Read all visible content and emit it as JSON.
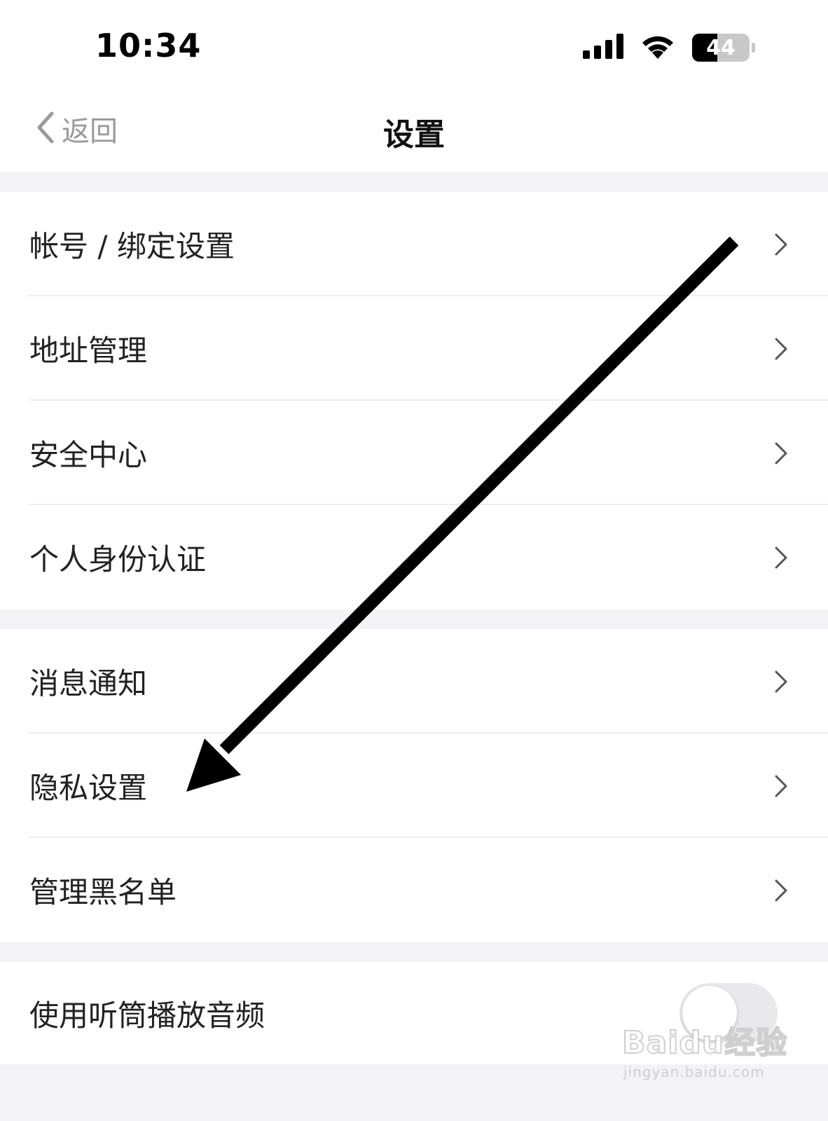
{
  "status_bar": {
    "time": "10:34",
    "battery": "44",
    "battery_level": 0.44,
    "icons": [
      "signal-icon",
      "wifi-icon",
      "battery-icon"
    ]
  },
  "nav": {
    "back_label": "返回",
    "title": "设置"
  },
  "groups": [
    {
      "items": [
        {
          "label": "帐号 / 绑定设置"
        },
        {
          "label": "地址管理"
        },
        {
          "label": "安全中心"
        },
        {
          "label": "个人身份认证"
        }
      ]
    },
    {
      "items": [
        {
          "label": "消息通知"
        },
        {
          "label": "隐私设置"
        },
        {
          "label": "管理黑名单"
        }
      ]
    },
    {
      "items": [
        {
          "label": "使用听筒播放音频",
          "toggle": false
        }
      ]
    }
  ],
  "watermark": {
    "logo": "Baidu经验",
    "url": "jingyan.baidu.com"
  },
  "colors": {
    "background": "#ffffff",
    "separator": "#f3f3f5",
    "secondary_text": "#9a9a9a",
    "annotation_arrow": "#000000"
  }
}
